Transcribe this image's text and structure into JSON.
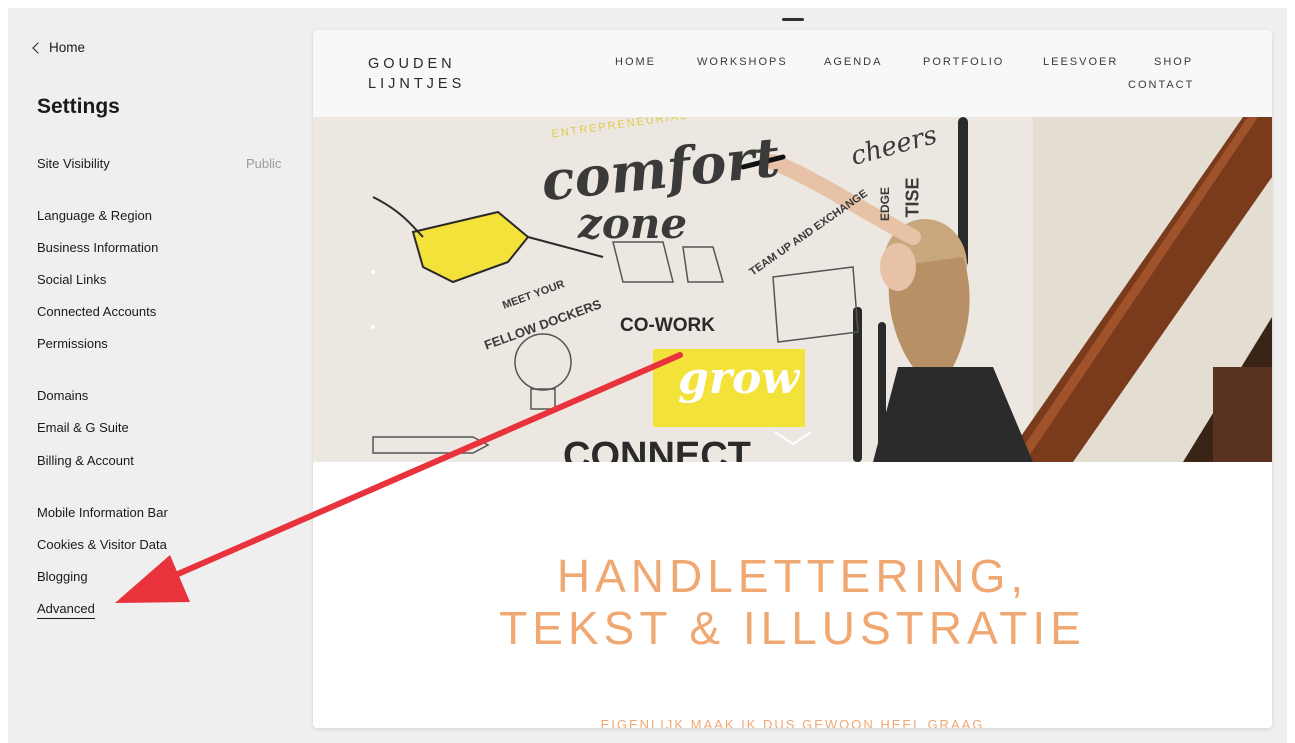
{
  "sidebar": {
    "back_label": "Home",
    "title": "Settings",
    "site_visibility": {
      "label": "Site Visibility",
      "value": "Public"
    },
    "group1": [
      "Language & Region",
      "Business Information",
      "Social Links",
      "Connected Accounts",
      "Permissions"
    ],
    "group2": [
      "Domains",
      "Email & G Suite",
      "Billing & Account"
    ],
    "group3": [
      "Mobile Information Bar",
      "Cookies & Visitor Data",
      "Blogging",
      "Advanced"
    ]
  },
  "site": {
    "logo_line1": "GOUDEN",
    "logo_line2": "LIJNTJES",
    "nav": [
      "HOME",
      "WORKSHOPS",
      "AGENDA",
      "PORTFOLIO",
      "LEESVOER",
      "SHOP",
      "CONTACT"
    ],
    "hero_words": {
      "comfort": "comfort",
      "zone": "zone",
      "entrepreneurial": "ENTREPRENEURIAL",
      "cheers": "cheers",
      "meet": "MEET YOUR",
      "fellow": "FELLOW DOCKERS",
      "cowork": "CO-WORK",
      "grow": "grow",
      "connect": "CONNECT",
      "team": "TEAM UP AND EXCHANGE",
      "edge": "EDGE",
      "tise": "TISE"
    },
    "headline_line1": "HANDLETTERING,",
    "headline_line2": "TEKST & ILLUSTRATIE",
    "subheadline": "EIGENLIJK MAAK IK DUS GEWOON HEEL GRAAG"
  },
  "colors": {
    "accent_orange": "#f0a873",
    "arrow_red": "#e8323c",
    "sidebar_bg": "#efefef",
    "hero_yellow": "#f3e23a"
  }
}
